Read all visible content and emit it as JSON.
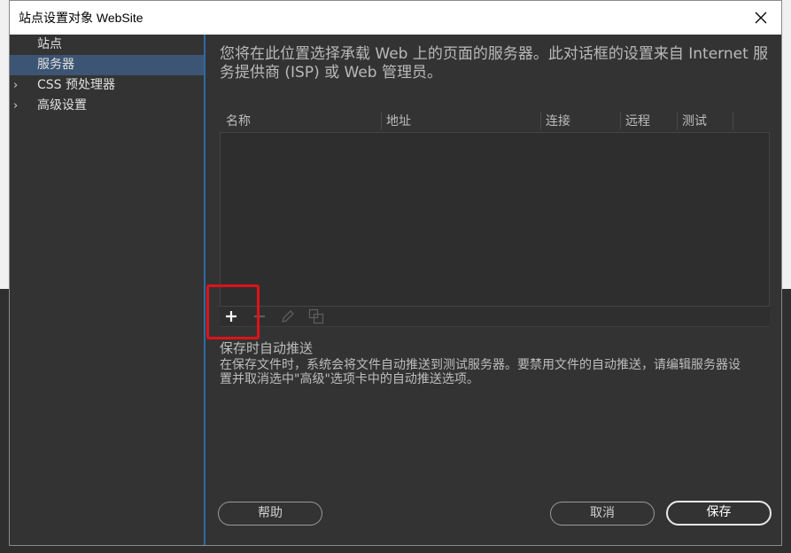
{
  "window": {
    "title": "站点设置对象 WebSite"
  },
  "sidebar": {
    "items": [
      {
        "label": "站点",
        "expandable": false,
        "selected": false
      },
      {
        "label": "服务器",
        "expandable": false,
        "selected": true
      },
      {
        "label": "CSS 预处理器",
        "expandable": true,
        "selected": false
      },
      {
        "label": "高级设置",
        "expandable": true,
        "selected": false
      }
    ],
    "chevron": "›"
  },
  "main": {
    "intro": "您将在此位置选择承载 Web 上的页面的服务器。此对话框的设置来自 Internet 服务提供商 (ISP) 或 Web 管理员。",
    "table": {
      "columns": [
        "名称",
        "地址",
        "连接",
        "远程",
        "测试"
      ]
    },
    "toolbar": {
      "add": "+",
      "remove": "−",
      "edit_icon": "pencil-icon",
      "duplicate_icon": "duplicate-icon"
    },
    "autopush": {
      "title": "保存时自动推送",
      "description": "在保存文件时，系统会将文件自动推送到测试服务器。要禁用文件的自动推送，请编辑服务器设置并取消选中\"高级\"选项卡中的自动推送选项。"
    }
  },
  "footer": {
    "help": "帮助",
    "cancel": "取消",
    "save": "保存"
  },
  "colors": {
    "accent": "#2d6aa6",
    "selected_bg": "#3d5574",
    "highlight": "#e0121a"
  }
}
